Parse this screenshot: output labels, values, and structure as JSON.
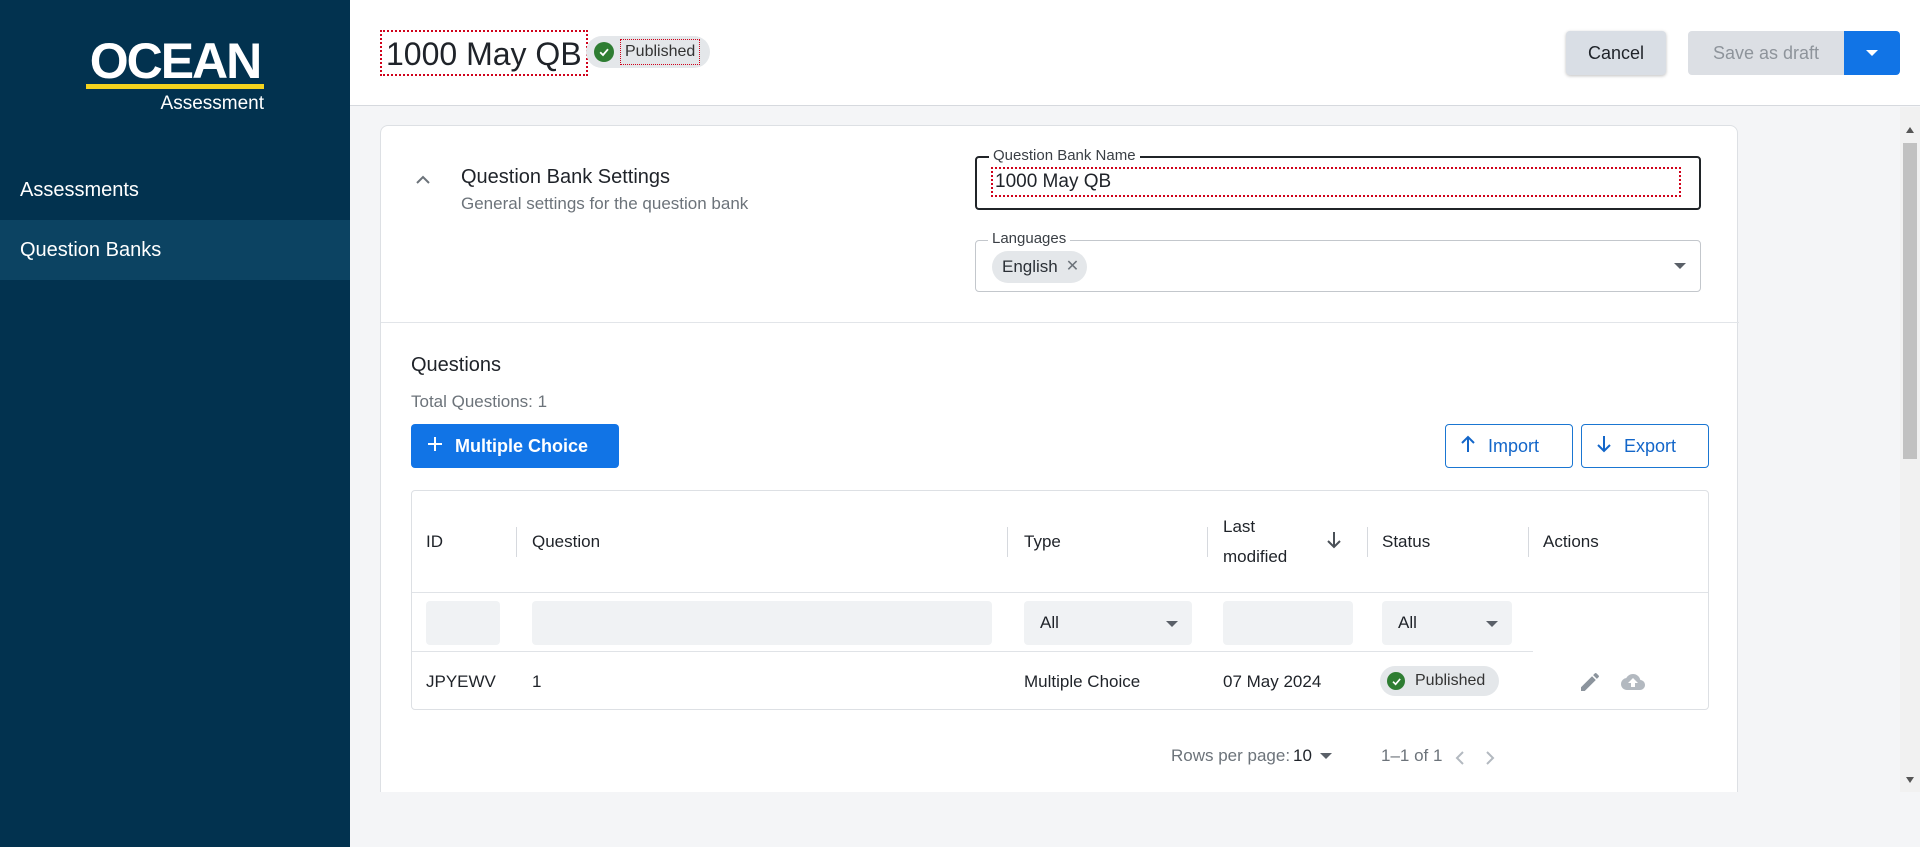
{
  "brand": {
    "name": "OCEAN",
    "subtitle": "Assessment",
    "accent_color": "#f4d31e"
  },
  "sidebar": {
    "items": [
      {
        "label": "Assessments",
        "active": false
      },
      {
        "label": "Question Banks",
        "active": true
      }
    ]
  },
  "header": {
    "title": "1000 May QB",
    "status": "Published",
    "cancel_label": "Cancel",
    "draft_label": "Save as draft"
  },
  "settings": {
    "title": "Question Bank Settings",
    "subtitle": "General settings for the question bank",
    "name_label": "Question Bank Name",
    "name_value": "1000 May QB",
    "languages_label": "Languages",
    "languages": [
      "English"
    ]
  },
  "questions": {
    "heading": "Questions",
    "total": "Total Questions: 1",
    "add_label": "Multiple Choice",
    "import_label": "Import",
    "export_label": "Export",
    "columns": {
      "id": "ID",
      "question": "Question",
      "type": "Type",
      "last_modified": "Last modified",
      "status": "Status",
      "actions": "Actions"
    },
    "filters": {
      "type": "All",
      "status": "All"
    },
    "rows": [
      {
        "id": "JPYEWV",
        "question": "1",
        "type": "Multiple Choice",
        "last_modified": "07 May 2024",
        "status": "Published"
      }
    ],
    "pagination": {
      "rows_per_page_label": "Rows per page:",
      "rows_per_page": "10",
      "range": "1–1 of 1"
    }
  },
  "colors": {
    "sidebar_bg": "#02324f",
    "primary": "#1174e6",
    "success": "#2e7d32"
  }
}
